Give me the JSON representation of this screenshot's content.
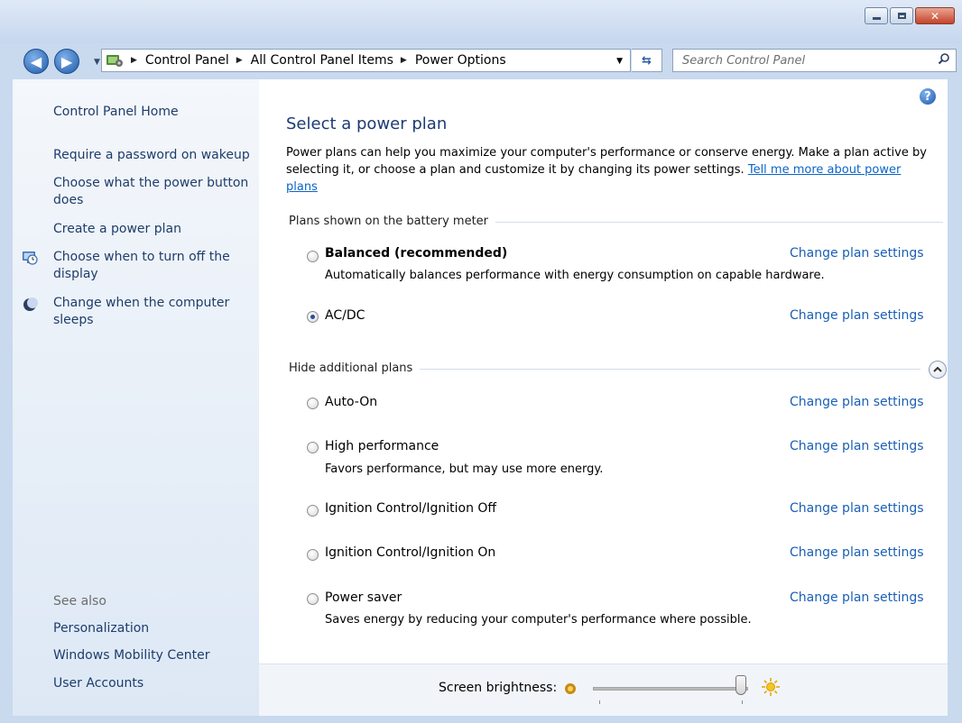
{
  "window": {
    "minimize_symbol": "",
    "close_symbol": "✕"
  },
  "navigation": {
    "breadcrumbs": [
      "Control Panel",
      "All Control Panel Items",
      "Power Options"
    ],
    "search_placeholder": "Search Control Panel"
  },
  "sidebar": {
    "links": [
      {
        "label": "Control Panel Home"
      },
      {
        "label": "Require a password on wakeup"
      },
      {
        "label": "Choose what the power button does"
      },
      {
        "label": "Create a power plan"
      },
      {
        "label": "Choose when to turn off the display",
        "icon": "monitor-clock-icon"
      },
      {
        "label": "Change when the computer sleeps",
        "icon": "moon-icon"
      }
    ],
    "see_also_heading": "See also",
    "see_also": [
      "Personalization",
      "Windows Mobility Center",
      "User Accounts"
    ]
  },
  "main": {
    "title": "Select a power plan",
    "intro": "Power plans can help you maximize your computer's performance or conserve energy. Make a plan active by selecting it, or choose a plan and customize it by changing its power settings.",
    "intro_link": "Tell me more about power plans",
    "battery_section": "Plans shown on the battery meter",
    "additional_section": "Hide additional plans",
    "change_link": "Change plan settings",
    "plans": [
      {
        "name": "Balanced (recommended)",
        "description": "Automatically balances performance with energy consumption on capable hardware.",
        "selected": false
      },
      {
        "name": "AC/DC",
        "description": "",
        "selected": true
      },
      {
        "name": "Auto-On",
        "description": "",
        "selected": false
      },
      {
        "name": "High performance",
        "description": "Favors performance, but may use more energy.",
        "selected": false
      },
      {
        "name": "Ignition Control/Ignition Off",
        "description": "",
        "selected": false
      },
      {
        "name": "Ignition Control/Ignition On",
        "description": "",
        "selected": false
      },
      {
        "name": "Power saver",
        "description": "Saves energy by reducing your computer's performance where possible.",
        "selected": false
      }
    ],
    "brightness_label": "Screen brightness:",
    "brightness_level": 1.0
  },
  "colors": {
    "link": "#1a5fb4",
    "title": "#1d3a73",
    "radio_selected": "#2a4e9b"
  }
}
